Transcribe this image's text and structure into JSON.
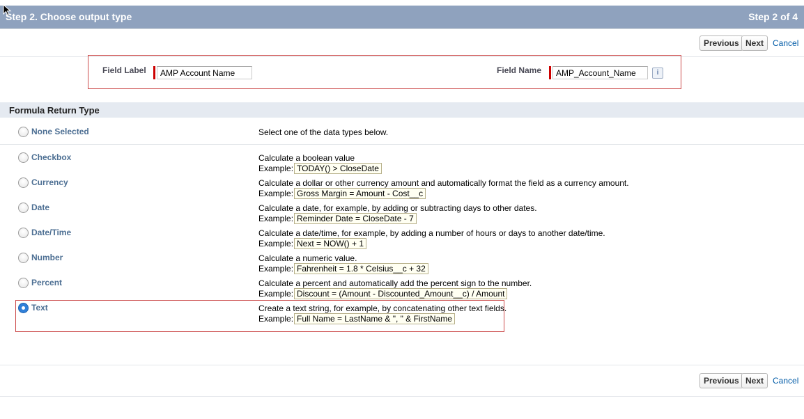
{
  "header": {
    "title": "Step 2. Choose output type",
    "step": "Step 2 of 4"
  },
  "buttons": {
    "previous": "Previous",
    "next": "Next",
    "cancel": "Cancel"
  },
  "fields": {
    "label_title": "Field Label",
    "label_value": "AMP Account Name",
    "name_title": "Field Name",
    "name_value": "AMP_Account_Name",
    "info_icon": "i"
  },
  "section": {
    "title": "Formula Return Type"
  },
  "example_label": "Example:",
  "types": [
    {
      "name": "None Selected",
      "description": "Select one of the data types below.",
      "example": "",
      "selected": false
    },
    {
      "name": "Checkbox",
      "description": "Calculate a boolean value",
      "example": "TODAY() > CloseDate",
      "selected": false
    },
    {
      "name": "Currency",
      "description": "Calculate a dollar or other currency amount and automatically format the field as a currency amount.",
      "example": "Gross Margin = Amount - Cost__c",
      "selected": false
    },
    {
      "name": "Date",
      "description": "Calculate a date, for example, by adding or subtracting days to other dates.",
      "example": "Reminder Date = CloseDate - 7",
      "selected": false
    },
    {
      "name": "Date/Time",
      "description": "Calculate a date/time, for example, by adding a number of hours or days to another date/time.",
      "example": "Next = NOW() + 1",
      "selected": false
    },
    {
      "name": "Number",
      "description": "Calculate a numeric value.",
      "example": "Fahrenheit = 1.8 * Celsius__c + 32",
      "selected": false
    },
    {
      "name": "Percent",
      "description": "Calculate a percent and automatically add the percent sign to the number.",
      "example": "Discount = (Amount - Discounted_Amount__c) / Amount",
      "selected": false
    },
    {
      "name": "Text",
      "description": "Create a text string, for example, by concatenating other text fields.",
      "example": "Full Name = LastName & \", \" & FirstName",
      "selected": true
    }
  ]
}
